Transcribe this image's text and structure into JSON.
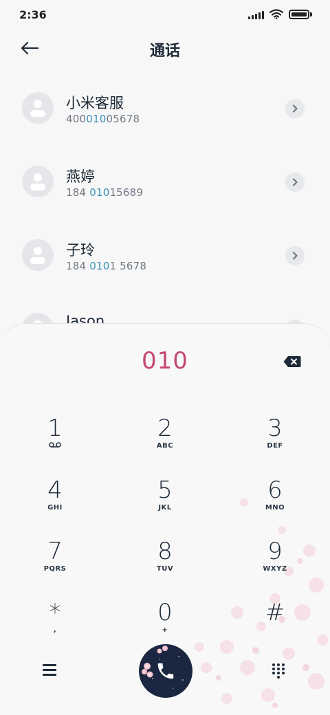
{
  "status_bar": {
    "time": "2:36"
  },
  "header": {
    "title": "通话"
  },
  "contacts": [
    {
      "name": "小米客服",
      "number_pre": "400",
      "number_match": "010",
      "number_post": "05678"
    },
    {
      "name": "燕婷",
      "number_pre": "184 ",
      "number_match": "010",
      "number_post": "15689"
    },
    {
      "name": "子玲",
      "number_pre": "184 ",
      "number_match": "010",
      "number_post": "1 5678"
    },
    {
      "name": "Jason",
      "number_pre": "",
      "number_match": "",
      "number_post": ""
    }
  ],
  "dialer": {
    "number": "010",
    "keys": [
      {
        "digit": "1",
        "letters": ""
      },
      {
        "digit": "2",
        "letters": "ABC"
      },
      {
        "digit": "3",
        "letters": "DEF"
      },
      {
        "digit": "4",
        "letters": "GHI"
      },
      {
        "digit": "5",
        "letters": "JKL"
      },
      {
        "digit": "6",
        "letters": "MNO"
      },
      {
        "digit": "7",
        "letters": "PQRS"
      },
      {
        "digit": "8",
        "letters": "TUV"
      },
      {
        "digit": "9",
        "letters": "WXYZ"
      },
      {
        "digit": "*",
        "letters": ","
      },
      {
        "digit": "0",
        "letters": "+"
      },
      {
        "digit": "#",
        "letters": ""
      }
    ],
    "key_1_icon": "voicemail-icon"
  },
  "colors": {
    "dialed_number": "#c4486e",
    "match_highlight": "#3b8fb5",
    "call_button": "#1b2740"
  }
}
